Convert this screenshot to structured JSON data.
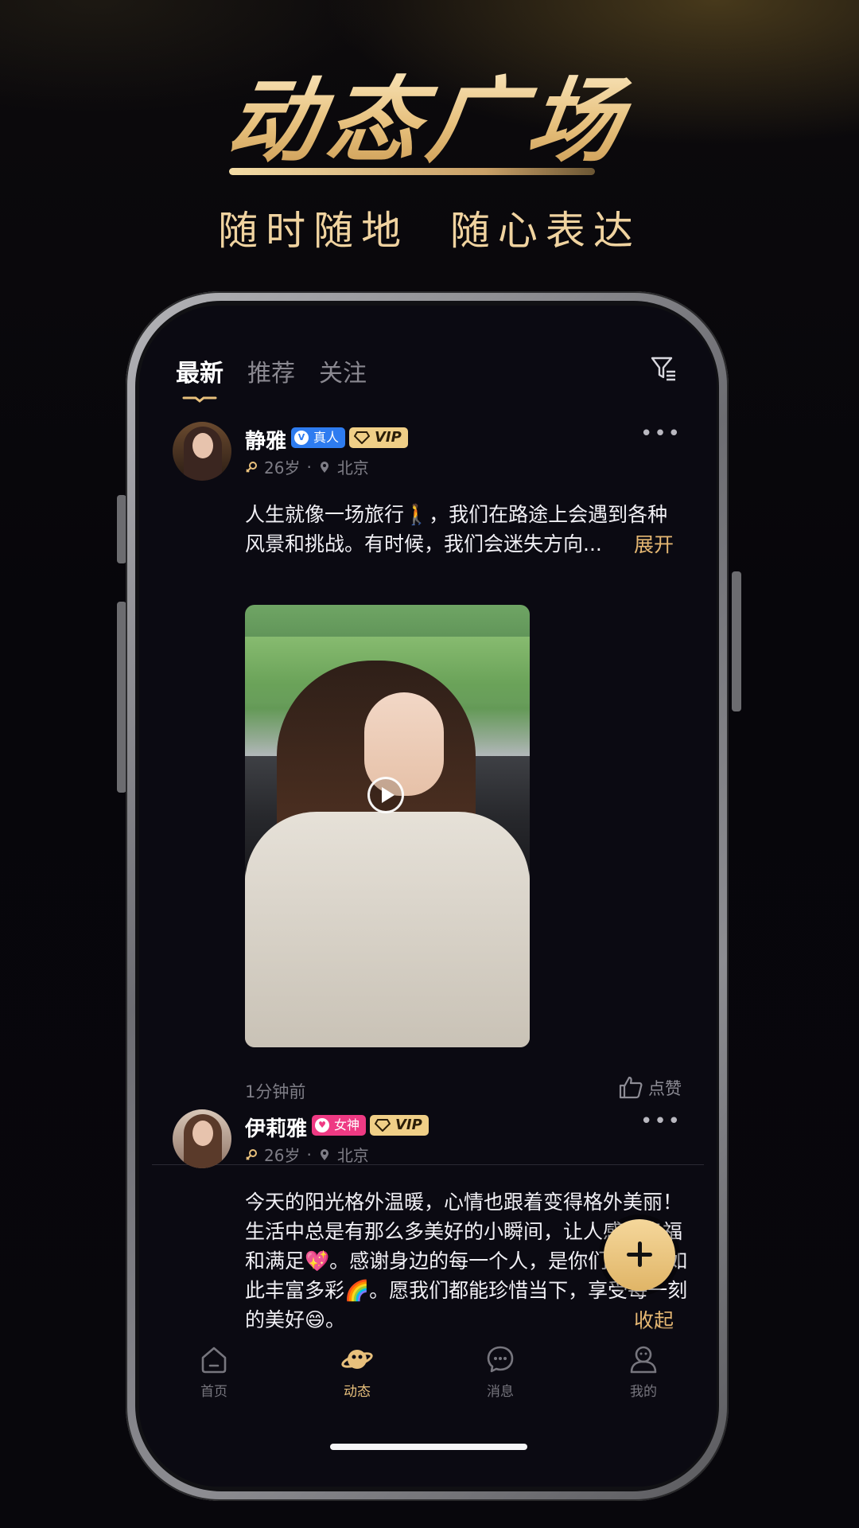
{
  "promo": {
    "title": "动态广场",
    "subtitle": "随时随地  随心表达"
  },
  "tabs": [
    {
      "label": "最新",
      "active": true
    },
    {
      "label": "推荐",
      "active": false
    },
    {
      "label": "关注",
      "active": false
    }
  ],
  "posts": [
    {
      "username": "静雅",
      "badge_label": "真人",
      "badge_color": "#2e7cf0",
      "vip_label": "VIP",
      "age": "26岁",
      "city": "北京",
      "text": "人生就像一场旅行🚶，我们在路途上会遇到各种风景和挑战。有时候，我们会迷失方向...",
      "expand_label": "展开",
      "time": "1分钟前",
      "like_label": "点赞"
    },
    {
      "username": "伊莉雅",
      "badge_label": "女神",
      "badge_color": "#ee3a83",
      "vip_label": "VIP",
      "age": "26岁",
      "city": "北京",
      "text": "今天的阳光格外温暖，心情也跟着变得格外美丽！生活中总是有那么多美好的小瞬间，让人感到幸福和满足💖。感谢身边的每一个人，是你们让生活如此丰富多彩🌈。愿我们都能珍惜当下，享受每一刻的美好😄。",
      "collapse_label": "收起"
    }
  ],
  "bottom_nav": [
    {
      "label": "首页",
      "icon": "home-icon",
      "active": false
    },
    {
      "label": "动态",
      "icon": "planet-icon",
      "active": true
    },
    {
      "label": "消息",
      "icon": "message-icon",
      "active": false
    },
    {
      "label": "我的",
      "icon": "profile-icon",
      "active": false
    }
  ],
  "colors": {
    "accent_gold": "#e8c07c",
    "background": "#0b0a12"
  }
}
